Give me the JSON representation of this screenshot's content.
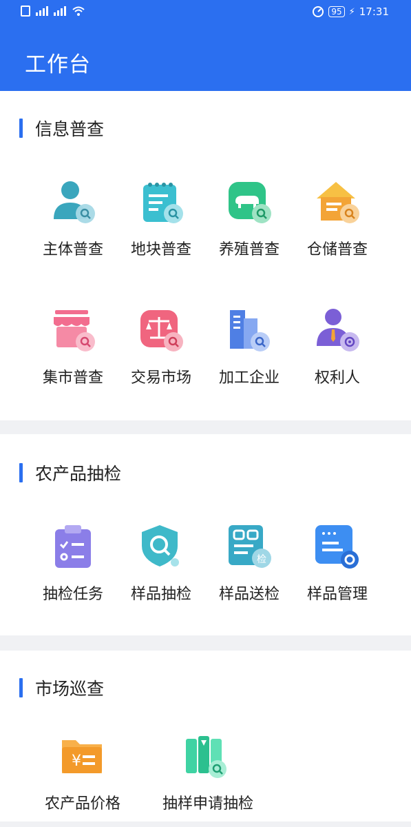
{
  "status_bar": {
    "time": "17:31",
    "battery": "95"
  },
  "header": {
    "title": "工作台"
  },
  "sections": [
    {
      "title": "信息普查",
      "items": [
        {
          "label": "主体普查",
          "icon": "person-search-icon"
        },
        {
          "label": "地块普查",
          "icon": "land-notepad-search-icon"
        },
        {
          "label": "养殖普查",
          "icon": "livestock-search-icon"
        },
        {
          "label": "仓储普查",
          "icon": "warehouse-search-icon"
        },
        {
          "label": "集市普查",
          "icon": "market-stall-search-icon"
        },
        {
          "label": "交易市场",
          "icon": "scale-search-icon"
        },
        {
          "label": "加工企业",
          "icon": "building-search-icon"
        },
        {
          "label": "权利人",
          "icon": "rights-holder-gear-icon"
        }
      ]
    },
    {
      "title": "农产品抽检",
      "items": [
        {
          "label": "抽检任务",
          "icon": "clipboard-task-icon"
        },
        {
          "label": "样品抽检",
          "icon": "shield-search-icon"
        },
        {
          "label": "样品送检",
          "icon": "sample-send-icon",
          "badge": "检"
        },
        {
          "label": "样品管理",
          "icon": "sample-manage-gear-icon"
        }
      ]
    },
    {
      "title": "市场巡查",
      "items": [
        {
          "label": "农产品价格",
          "icon": "price-folder-icon",
          "symbol": "¥"
        },
        {
          "label": "抽样申请抽检",
          "icon": "sample-request-search-icon"
        }
      ]
    }
  ],
  "colors": {
    "header": "#2b6ff0",
    "accent_bar": "#2b6ff0",
    "teal": "#3aa6bd",
    "green": "#2fc488",
    "orange": "#f3a436",
    "pink": "#f26d8f",
    "blue": "#4f7fe4",
    "purple": "#7b5fd6"
  }
}
